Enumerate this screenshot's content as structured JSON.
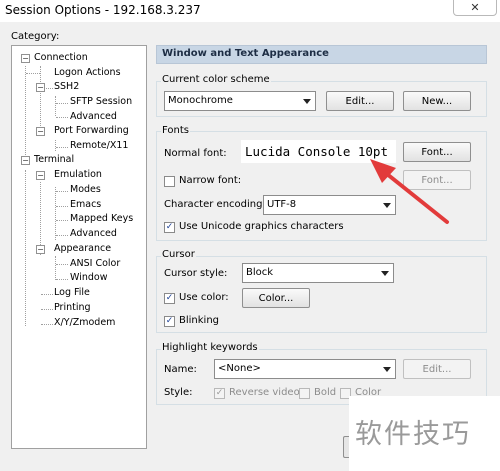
{
  "window": {
    "title": "Session Options - 192.168.3.237",
    "close_glyph": "✕"
  },
  "category": {
    "label": "Category:",
    "tree": [
      {
        "label": "Connection",
        "box": "−"
      },
      {
        "label": "Logon Actions"
      },
      {
        "label": "SSH2",
        "box": "−"
      },
      {
        "label": "SFTP Session"
      },
      {
        "label": "Advanced"
      },
      {
        "label": "Port Forwarding",
        "box": "−"
      },
      {
        "label": "Remote/X11"
      },
      {
        "label": "Terminal",
        "box": "−"
      },
      {
        "label": "Emulation",
        "box": "−"
      },
      {
        "label": "Modes"
      },
      {
        "label": "Emacs"
      },
      {
        "label": "Mapped Keys"
      },
      {
        "label": "Advanced"
      },
      {
        "label": "Appearance",
        "box": "−"
      },
      {
        "label": "ANSI Color"
      },
      {
        "label": "Window"
      },
      {
        "label": "Log File"
      },
      {
        "label": "Printing"
      },
      {
        "label": "X/Y/Zmodem"
      }
    ]
  },
  "panel": {
    "header": "Window and Text Appearance",
    "color_scheme": {
      "title": "Current color scheme",
      "selected": "Monochrome",
      "edit_label": "Edit...",
      "new_label": "New..."
    },
    "fonts": {
      "title": "Fonts",
      "normal_font_label": "Normal font:",
      "normal_font_value": "Lucida Console 10pt",
      "font_button": "Font...",
      "narrow_font_label": "Narrow font:",
      "narrow_font_checked": false,
      "narrow_font_button": "Font...",
      "encoding_label": "Character encoding:",
      "encoding_value": "UTF-8",
      "unicode_label": "Use Unicode graphics characters",
      "unicode_checked": true
    },
    "cursor": {
      "title": "Cursor",
      "style_label": "Cursor style:",
      "style_value": "Block",
      "use_color_label": "Use color:",
      "use_color_checked": true,
      "color_button": "Color...",
      "blinking_label": "Blinking",
      "blinking_checked": true
    },
    "highlight": {
      "title": "Highlight keywords",
      "name_label": "Name:",
      "name_value": "<None>",
      "edit_label": "Edit...",
      "style_label": "Style:",
      "reverse_video_label": "Reverse video",
      "reverse_video_checked": true,
      "bold_label": "Bold",
      "bold_checked": false,
      "color_label": "Color",
      "color_checked": false
    }
  },
  "annotation": {
    "arrow_color": "#e23b3b"
  },
  "watermark": {
    "text": "软件技巧"
  },
  "check_glyph": "✓"
}
